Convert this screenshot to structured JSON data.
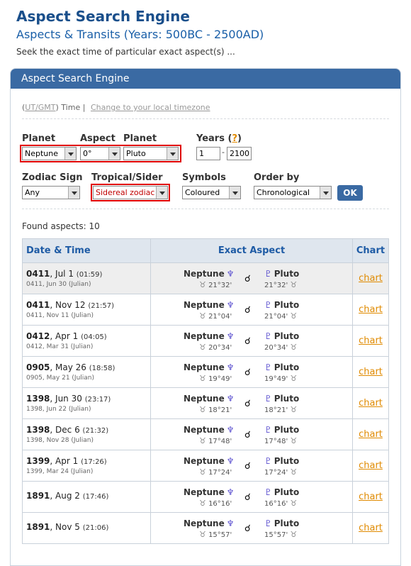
{
  "header": {
    "title": "Aspect Search Engine",
    "subtitle": "Aspects & Transits (Years: 500BC - 2500AD)",
    "description": "Seek the exact time of particular exact aspect(s) ..."
  },
  "panel": {
    "title": "Aspect Search Engine",
    "tz_prefix": "(",
    "tz_utgmt": "UT/GMT",
    "tz_suffix": ") Time |",
    "tz_link": "Change to your local timezone"
  },
  "form": {
    "planet1_label": "Planet",
    "aspect_label": "Aspect",
    "planet2_label": "Planet",
    "years_label": "Years (",
    "years_help": "?",
    "years_close": ")",
    "planet1_value": "Neptune",
    "aspect_value": "0°",
    "planet2_value": "Pluto",
    "year_from": "1",
    "year_dash": "-",
    "year_to": "2100",
    "zodiac_label": "Zodiac Sign",
    "tropical_label": "Tropical/Sider",
    "symbols_label": "Symbols",
    "order_label": "Order by",
    "zodiac_value": "Any",
    "tropical_value": "Sidereal zodiac (",
    "symbols_value": "Coloured",
    "order_value": "Chronological",
    "ok_label": "OK"
  },
  "results": {
    "found_text": "Found aspects: 10",
    "columns": [
      "Date & Time",
      "Exact Aspect",
      "Chart"
    ],
    "chart_link": "chart",
    "rows": [
      {
        "year": "0411",
        "date": ", Jul 1",
        "time": "(01:59)",
        "julian": "0411, Jun 30 (Julian)",
        "p1": "Neptune",
        "pos1": "21°32'",
        "p2": "Pluto",
        "pos2": "21°32'"
      },
      {
        "year": "0411",
        "date": ", Nov 12",
        "time": "(21:57)",
        "julian": "0411, Nov 11 (Julian)",
        "p1": "Neptune",
        "pos1": "21°04'",
        "p2": "Pluto",
        "pos2": "21°04'"
      },
      {
        "year": "0412",
        "date": ", Apr 1",
        "time": "(04:05)",
        "julian": "0412, Mar 31 (Julian)",
        "p1": "Neptune",
        "pos1": "20°34'",
        "p2": "Pluto",
        "pos2": "20°34'"
      },
      {
        "year": "0905",
        "date": ", May 26",
        "time": "(18:58)",
        "julian": "0905, May 21 (Julian)",
        "p1": "Neptune",
        "pos1": "19°49'",
        "p2": "Pluto",
        "pos2": "19°49'"
      },
      {
        "year": "1398",
        "date": ", Jun 30",
        "time": "(23:17)",
        "julian": "1398, Jun 22 (Julian)",
        "p1": "Neptune",
        "pos1": "18°21'",
        "p2": "Pluto",
        "pos2": "18°21'"
      },
      {
        "year": "1398",
        "date": ", Dec 6",
        "time": "(21:32)",
        "julian": "1398, Nov 28 (Julian)",
        "p1": "Neptune",
        "pos1": "17°48'",
        "p2": "Pluto",
        "pos2": "17°48'"
      },
      {
        "year": "1399",
        "date": ", Apr 1",
        "time": "(17:26)",
        "julian": "1399, Mar 24 (Julian)",
        "p1": "Neptune",
        "pos1": "17°24'",
        "p2": "Pluto",
        "pos2": "17°24'"
      },
      {
        "year": "1891",
        "date": ", Aug 2",
        "time": "(17:46)",
        "julian": "",
        "p1": "Neptune",
        "pos1": "16°16'",
        "p2": "Pluto",
        "pos2": "16°16'"
      },
      {
        "year": "1891",
        "date": ", Nov 5",
        "time": "(21:06)",
        "julian": "",
        "p1": "Neptune",
        "pos1": "15°57'",
        "p2": "Pluto",
        "pos2": "15°57'"
      }
    ]
  },
  "icons": {
    "neptune": "neptune-icon",
    "pluto": "pluto-icon",
    "conjunction": "conjunction-icon",
    "taurus": "taurus-icon"
  },
  "colors": {
    "brand": "#1a4f8b",
    "panel_header": "#3a6aa3",
    "highlight": "#e00000",
    "link": "#e08a00"
  }
}
